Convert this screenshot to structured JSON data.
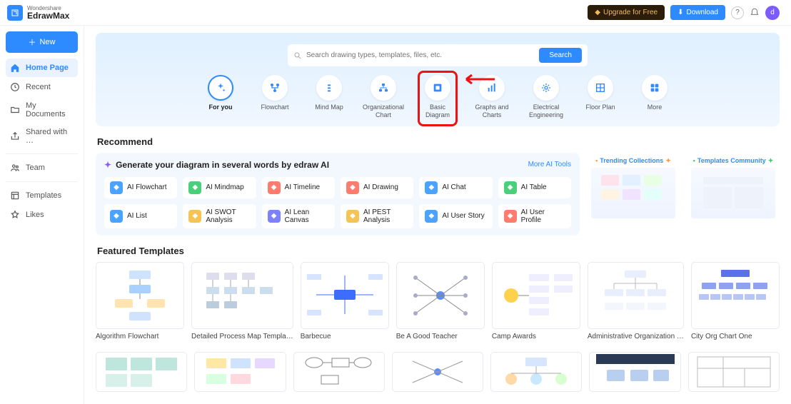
{
  "brand": {
    "small": "Wondershare",
    "big": "EdrawMax"
  },
  "topbar": {
    "upgrade": "Upgrade for Free",
    "download": "Download"
  },
  "sidebar": {
    "new": "New",
    "items": [
      {
        "icon": "home-icon",
        "label": "Home Page",
        "active": true
      },
      {
        "icon": "clock-icon",
        "label": "Recent"
      },
      {
        "icon": "folder-icon",
        "label": "My Documents"
      },
      {
        "icon": "share-icon",
        "label": "Shared with …"
      }
    ],
    "items2": [
      {
        "icon": "team-icon",
        "label": "Team"
      }
    ],
    "items3": [
      {
        "icon": "template-icon",
        "label": "Templates"
      },
      {
        "icon": "star-icon",
        "label": "Likes"
      }
    ]
  },
  "hero": {
    "search_placeholder": "Search drawing types, templates, files, etc.",
    "search_btn": "Search",
    "categories": [
      {
        "label": "For you",
        "icon": "sparkle-icon",
        "active": true
      },
      {
        "label": "Flowchart",
        "icon": "flow-icon"
      },
      {
        "label": "Mind Map",
        "icon": "mind-icon"
      },
      {
        "label": "Organizational Chart",
        "icon": "org-icon"
      },
      {
        "label": "Basic Diagram",
        "icon": "diagram-icon",
        "highlight": true
      },
      {
        "label": "Graphs and Charts",
        "icon": "chart-icon"
      },
      {
        "label": "Electrical Engineering",
        "icon": "elec-icon"
      },
      {
        "label": "Floor Plan",
        "icon": "floor-icon"
      },
      {
        "label": "More",
        "icon": "more-icon"
      }
    ]
  },
  "recommend_title": "Recommend",
  "ai": {
    "headline": "Generate your diagram in several words by edraw AI",
    "more": "More AI Tools",
    "items": [
      {
        "label": "AI Flowchart",
        "color": "#4aa3ff"
      },
      {
        "label": "AI Mindmap",
        "color": "#4ad07a"
      },
      {
        "label": "AI Timeline",
        "color": "#ff7b6e"
      },
      {
        "label": "AI Drawing",
        "color": "#ff7b6e"
      },
      {
        "label": "AI Chat",
        "color": "#4aa3ff"
      },
      {
        "label": "AI Table",
        "color": "#4ad07a"
      },
      {
        "label": "AI List",
        "color": "#4aa3ff"
      },
      {
        "label": "AI SWOT Analysis",
        "color": "#f6c455"
      },
      {
        "label": "AI Lean Canvas",
        "color": "#7c81ff"
      },
      {
        "label": "AI PEST Analysis",
        "color": "#f6c455"
      },
      {
        "label": "AI User Story",
        "color": "#4aa3ff"
      },
      {
        "label": "AI User Profile",
        "color": "#ff7b6e"
      }
    ],
    "promo1": "Trending Collections",
    "promo2": "Templates Community"
  },
  "featured_title": "Featured Templates",
  "templates_row1": [
    "Algorithm Flowchart",
    "Detailed Process Map Templa…",
    "Barbecue",
    "Be A Good Teacher",
    "Camp Awards",
    "Administrative Organization …",
    "City Org Chart One"
  ]
}
